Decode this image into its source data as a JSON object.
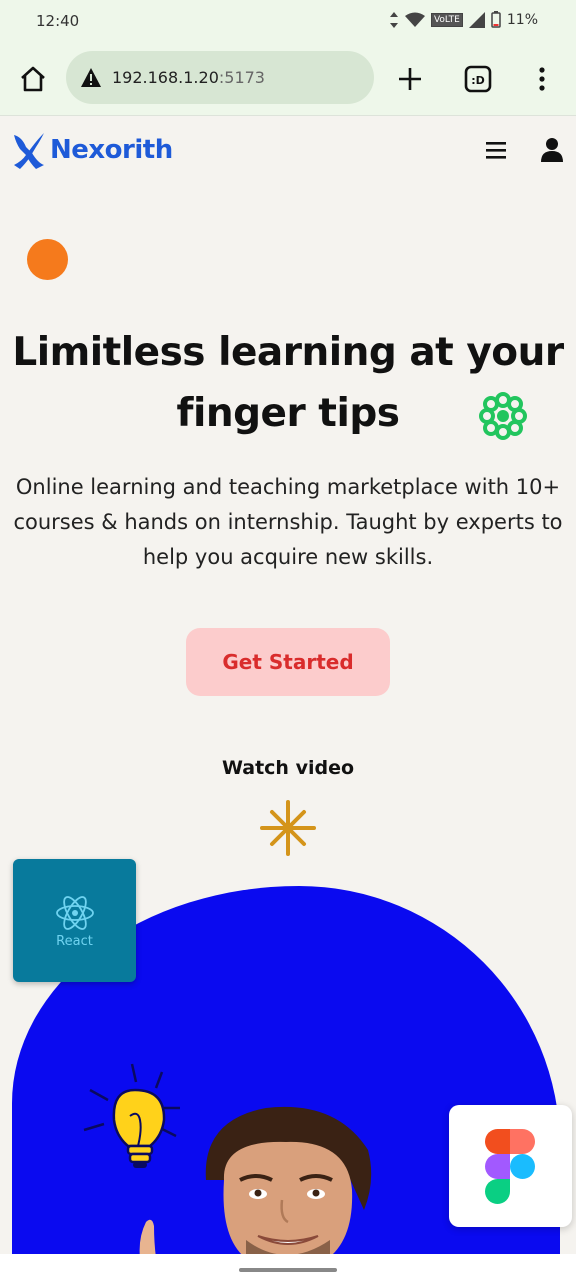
{
  "status_bar": {
    "time": "12:40",
    "battery": "11%",
    "network": "VoLTE"
  },
  "browser": {
    "url_host": "192.168.1.20",
    "url_port": ":5173",
    "icons": [
      "home-icon",
      "warning-icon",
      "plus-icon",
      "tabs-icon",
      "more-vert-icon"
    ]
  },
  "site": {
    "brand": "Nexorith",
    "icons": [
      "menu-icon",
      "user-icon"
    ]
  },
  "hero": {
    "title_line1": "Limitless learning at your",
    "title_line2": "finger tips",
    "subtitle": "Online learning and teaching marketplace with 10+ courses & hands on internship. Taught by experts to help you acquire new skills.",
    "cta_label": "Get Started",
    "watch_label": "Watch video"
  },
  "cards": {
    "react_label": "React"
  },
  "colors": {
    "brand_blue": "#1e5ad8",
    "hero_blue": "#0a0af0",
    "cta_bg": "#fccccc",
    "cta_text": "#d92c2c",
    "accent_orange": "#f57a1c",
    "accent_green": "#22c55e",
    "react_card": "#087a9c"
  }
}
